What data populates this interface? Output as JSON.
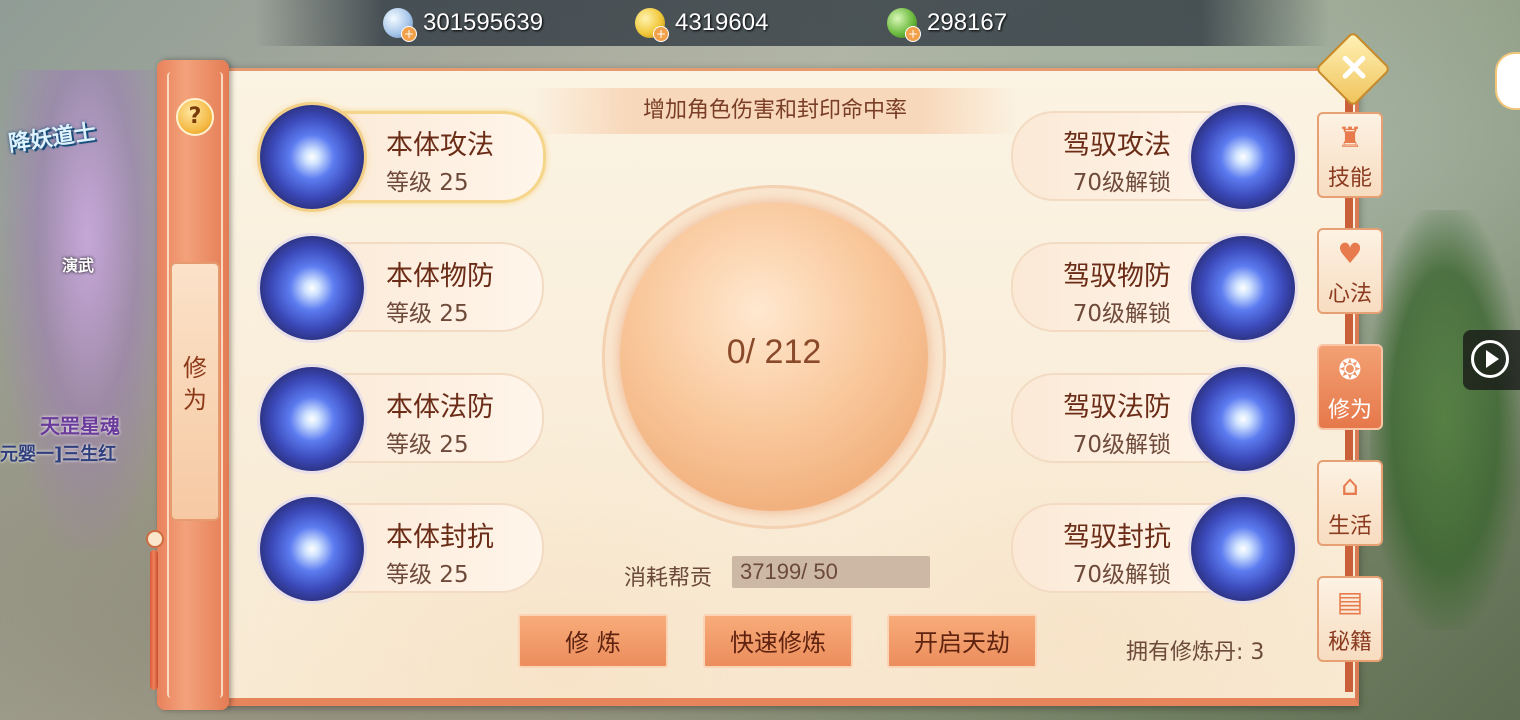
{
  "currencies": [
    {
      "icon": "silver-coin-icon",
      "value": "301595639"
    },
    {
      "icon": "gold-coin-icon",
      "value": "4319604"
    },
    {
      "icon": "jade-coin-icon",
      "value": "298167"
    }
  ],
  "background": {
    "labels": [
      "降妖道士",
      "天罡星魂",
      "元婴一]三生红",
      "演武"
    ]
  },
  "side_panel": {
    "help": "?",
    "title": "修\n为"
  },
  "description": "增加角色伤害和封印命中率",
  "progress": {
    "text": "0/ 212",
    "current": 0,
    "max": 212
  },
  "left_skills": [
    {
      "name": "本体攻法",
      "level": "等级 25",
      "selected": true
    },
    {
      "name": "本体物防",
      "level": "等级 25",
      "selected": false
    },
    {
      "name": "本体法防",
      "level": "等级 25",
      "selected": false
    },
    {
      "name": "本体封抗",
      "level": "等级 25",
      "selected": false
    }
  ],
  "right_skills": [
    {
      "name": "驾驭攻法",
      "level": "70级解锁"
    },
    {
      "name": "驾驭物防",
      "level": "70级解锁"
    },
    {
      "name": "驾驭法防",
      "level": "70级解锁"
    },
    {
      "name": "驾驭封抗",
      "level": "70级解锁"
    }
  ],
  "cost": {
    "label": "消耗帮贡",
    "value": "37199/ 50"
  },
  "buttons": {
    "cultivate": "修 炼",
    "quick_cultivate": "快速修炼",
    "open_tribulation": "开启天劫"
  },
  "pills": "拥有修炼丹: 3",
  "tabs": [
    {
      "icon": "skill-icon",
      "label": "技能",
      "active": false
    },
    {
      "icon": "mind-method-icon",
      "label": "心法",
      "active": false
    },
    {
      "icon": "cultivation-icon",
      "label": "修为",
      "active": true
    },
    {
      "icon": "life-icon",
      "label": "生活",
      "active": false
    },
    {
      "icon": "secret-book-icon",
      "label": "秘籍",
      "active": false
    }
  ],
  "colors": {
    "accent": "#e6845c",
    "panel": "#fbf3e3",
    "text_dark": "#6b2c17"
  }
}
